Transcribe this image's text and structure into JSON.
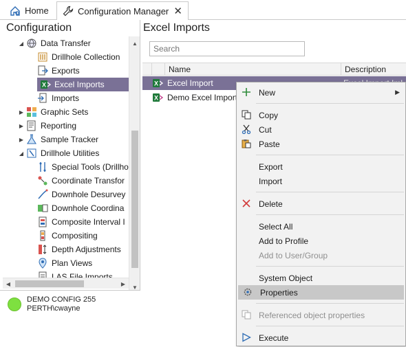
{
  "tabs": [
    {
      "label": "Home",
      "icon": "home-icon"
    },
    {
      "label": "Configuration Manager",
      "icon": "wrench-icon",
      "close": "✕"
    }
  ],
  "left_panel": {
    "title": "Configuration",
    "tree": [
      {
        "label": "Data Transfer",
        "icon": "globe-icon",
        "arrow": "◢",
        "indent": 1
      },
      {
        "label": "Drillhole Collection",
        "icon": "drillhole-collection-icon",
        "arrow": "",
        "indent": 2
      },
      {
        "label": "Exports",
        "icon": "export-icon",
        "arrow": "",
        "indent": 2
      },
      {
        "label": "Excel Imports",
        "icon": "excel-icon",
        "arrow": "",
        "indent": 2,
        "selected": true
      },
      {
        "label": "Imports",
        "icon": "import-icon",
        "arrow": "",
        "indent": 2
      },
      {
        "label": "Graphic Sets",
        "icon": "graphic-sets-icon",
        "arrow": "▶",
        "indent": 1
      },
      {
        "label": "Reporting",
        "icon": "reporting-icon",
        "arrow": "▶",
        "indent": 1
      },
      {
        "label": "Sample Tracker",
        "icon": "flask-icon",
        "arrow": "▶",
        "indent": 1
      },
      {
        "label": "Drillhole Utilities",
        "icon": "drillhole-utilities-icon",
        "arrow": "◢",
        "indent": 1
      },
      {
        "label": "Special Tools (Drillho",
        "icon": "special-tools-icon",
        "arrow": "",
        "indent": 2
      },
      {
        "label": "Coordinate Transfor",
        "icon": "coordinate-transform-icon",
        "arrow": "",
        "indent": 2
      },
      {
        "label": "Downhole Desurvey",
        "icon": "downhole-desurvey-icon",
        "arrow": "",
        "indent": 2
      },
      {
        "label": "Downhole Coordina",
        "icon": "downhole-coordinate-icon",
        "arrow": "",
        "indent": 2
      },
      {
        "label": "Composite Interval I",
        "icon": "composite-interval-icon",
        "arrow": "",
        "indent": 2
      },
      {
        "label": "Compositing",
        "icon": "compositing-icon",
        "arrow": "",
        "indent": 2
      },
      {
        "label": "Depth Adjustments",
        "icon": "depth-adjustments-icon",
        "arrow": "",
        "indent": 2
      },
      {
        "label": "Plan Views",
        "icon": "plan-views-icon",
        "arrow": "",
        "indent": 2
      },
      {
        "label": "LAS File Imports",
        "icon": "las-file-icon",
        "arrow": "",
        "indent": 2
      }
    ],
    "status": {
      "line1": "DEMO CONFIG 255",
      "line2": "PERTH\\cwayne",
      "color": "#7ee040"
    }
  },
  "right_panel": {
    "title": "Excel Imports",
    "search_placeholder": "Search",
    "columns": [
      "Name",
      "Description"
    ],
    "rows": [
      {
        "name": "Excel Import",
        "description": "Excel Import Iml",
        "selected": true
      },
      {
        "name": "Demo Excel Import",
        "description": ""
      }
    ]
  },
  "context_menu": {
    "items": [
      {
        "label": "New",
        "icon": "plus-icon",
        "submenu": "▶"
      },
      {
        "label": "Copy",
        "icon": "copy-icon"
      },
      {
        "label": "Cut",
        "icon": "cut-icon"
      },
      {
        "label": "Paste",
        "icon": "paste-icon"
      },
      {
        "label": "Export",
        "icon": ""
      },
      {
        "label": "Import",
        "icon": ""
      },
      {
        "label": "Delete",
        "icon": "delete-icon"
      },
      {
        "label": "Select All",
        "icon": ""
      },
      {
        "label": "Add to Profile",
        "icon": ""
      },
      {
        "label": "Add to User/Group",
        "icon": "",
        "disabled": true
      },
      {
        "label": "System Object",
        "icon": ""
      },
      {
        "label": "Properties",
        "icon": "properties-icon",
        "highlighted": true
      },
      {
        "label": "Referenced object properties",
        "icon": "referenced-properties-icon",
        "disabled": true
      },
      {
        "label": "Execute",
        "icon": "play-icon"
      }
    ]
  },
  "colors": {
    "selection": "#7a7196",
    "menu_bg": "#f2f2f2",
    "menu_highlight": "#c8c8c8",
    "accent_blue": "#2f6db5",
    "excel_green": "#1f7a3a"
  }
}
